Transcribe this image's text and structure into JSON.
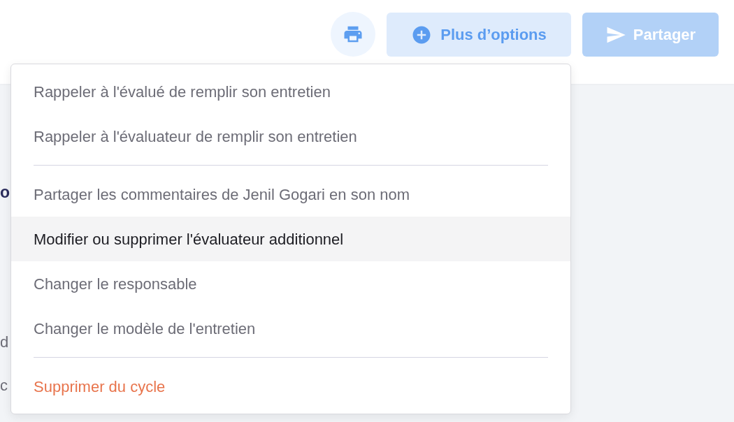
{
  "toolbar": {
    "more_options_button": {
      "label": "Plus d’options",
      "expanded": true
    },
    "share_button": {
      "label": "Partager",
      "disabled": true
    }
  },
  "page": {
    "heading": "o",
    "texts": [
      "d",
      "c"
    ]
  },
  "menu": {
    "sections": [
      {
        "items": [
          {
            "label": "Rappeler à l'évalué de remplir son entretien",
            "kind": "action",
            "highlighted": false
          },
          {
            "label": "Rappeler à l'évaluateur de remplir son entretien",
            "kind": "action",
            "highlighted": false
          }
        ]
      },
      {
        "items": [
          {
            "label": "Partager les commentaires de Jenil Gogari en son nom",
            "kind": "action",
            "highlighted": false
          },
          {
            "label": "Modifier ou supprimer l'évaluateur additionnel",
            "kind": "action",
            "highlighted": true
          },
          {
            "label": "Changer le responsable",
            "kind": "action",
            "highlighted": false
          },
          {
            "label": "Changer le modèle de l'entretien",
            "kind": "action",
            "highlighted": false
          }
        ]
      },
      {
        "items": [
          {
            "label": "Supprimer du cycle",
            "kind": "danger",
            "highlighted": false
          }
        ]
      }
    ]
  }
}
